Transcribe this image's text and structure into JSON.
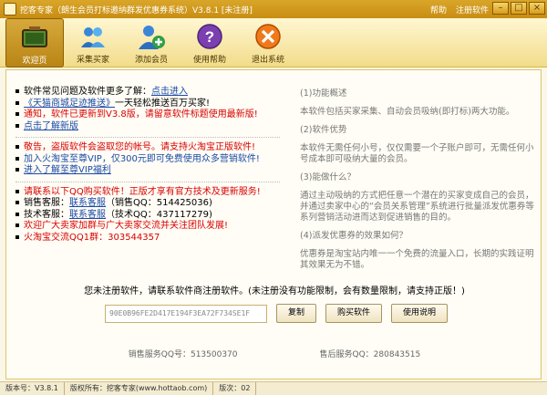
{
  "window": {
    "title": "挖客专家（朗生会员打标邀纳群发优惠券系统）V3.8.1 [未注册]",
    "menu_help": "帮助",
    "menu_register": "注册软件",
    "btn_min": "–",
    "btn_max": "□",
    "btn_close": "×"
  },
  "toolbar": [
    {
      "label": "欢迎页"
    },
    {
      "label": "采集买家"
    },
    {
      "label": "添加会员"
    },
    {
      "label": "使用帮助"
    },
    {
      "label": "退出系统"
    }
  ],
  "left": {
    "l1_text": "软件常见问题及软件更多了解：",
    "l1_link": "点击进入",
    "l2_link": "《天猫商城足迹推送》",
    "l2_text": "一天轻松推送百万买家!",
    "l3": "通知，软件已更新到V3.8版，请留意软件标题使用最新版!",
    "l4": "点击了解新版",
    "l5": "敬告，盗版软件会盗取您的帐号。请支持火淘宝正版软件!",
    "l6": "加入火淘宝至尊VIP，仅300元即可免费使用众多营销软件!",
    "l7": "进入了解至尊VIP福利",
    "l8": "请联系以下QQ购买软件！正版才享有官方技术及更新服务!",
    "l9_prefix": "销售客服：",
    "l9_link": "联系客服",
    "l9_suffix": "（销售QQ：514425036)",
    "l10_prefix": "技术客服：",
    "l10_link": "联系客服",
    "l10_suffix": "（技术QQ：437117279)",
    "l11": "欢迎广大卖家加群与广大卖家交流并关注团队发展!",
    "l12": "火淘宝交流QQ1群：303544357"
  },
  "right": {
    "p1": "(1)功能概述",
    "p2": "本软件包括买家采集、自动会员吸纳(即打标)两大功能。",
    "p3": "(2)软件优势",
    "p4": "本软件无需任何小号，仅仅需要一个子账户即可，无需任何小号成本即可吸纳大量的会员。",
    "p5": "(3)能做什么？",
    "p6": "通过主动吸纳的方式把任意一个潜在的买家变成自己的会员，并通过卖家中心的“会员关系管理”系统进行批量派发优惠券等系列营销活动进而达到促进销售的目的。",
    "p7": "(4)派发优惠券的效果如何？",
    "p8": "优惠券是淘宝站内唯一一个免费的流量入口，长期的实践证明其效果无为不错。"
  },
  "register": {
    "notice": "您未注册软件，请联系软件商注册软件。(未注册没有功能限制，会有数量限制，请支持正版！)",
    "serial": "90E0B96FE2D417E194F3EA72F734SE1F",
    "copy_btn": "复制",
    "buy_btn": "购买软件",
    "help_btn": "使用说明",
    "sales_qq": "销售服务QQ号：513500370",
    "after_qq": "售后服务QQ：280843515"
  },
  "status": {
    "version": "版本号：V3.8.1",
    "copyright": "版权所有：挖客专家(www.hottaob.com)",
    "count": "版次：02"
  }
}
